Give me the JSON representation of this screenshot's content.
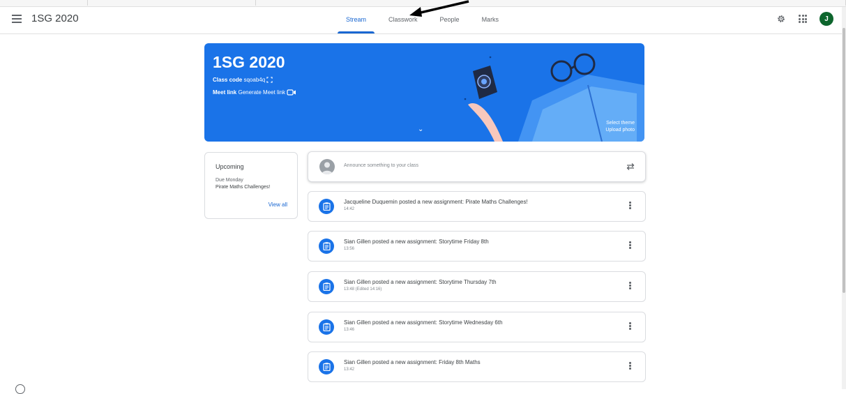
{
  "header": {
    "class_name": "1SG 2020",
    "tabs": [
      {
        "label": "Stream",
        "active": true
      },
      {
        "label": "Classwork",
        "active": false
      },
      {
        "label": "People",
        "active": false
      },
      {
        "label": "Marks",
        "active": false
      }
    ],
    "avatar_letter": "J",
    "icons": [
      "menu-icon",
      "gear-icon",
      "apps-icon"
    ]
  },
  "banner": {
    "title": "1SG 2020",
    "class_code_label": "Class code",
    "class_code": "sqoab4q",
    "meet_label": "Meet link",
    "meet_action": "Generate Meet link",
    "select_theme": "Select theme",
    "upload_photo": "Upload photo",
    "color": "#1a73e8"
  },
  "upcoming": {
    "title": "Upcoming",
    "due": "Due Monday",
    "item": "Pirate Maths Challenges!",
    "view_all": "View all"
  },
  "announce": {
    "placeholder": "Announce something to your class"
  },
  "posts": [
    {
      "title": "Jacqueline Duquemin posted a new assignment: Pirate Maths Challenges!",
      "time": "14:42"
    },
    {
      "title": "Sian Gillen posted a new assignment: Storytime Friday 8th",
      "time": "13:56"
    },
    {
      "title": "Sian Gillen posted a new assignment: Storytime Thursday 7th",
      "time": "13:48 (Edited 14:16)"
    },
    {
      "title": "Sian Gillen posted a new assignment: Storytime Wednesday 6th",
      "time": "13:46"
    },
    {
      "title": "Sian Gillen posted a new assignment: Friday 8th Maths",
      "time": "13:42"
    }
  ]
}
